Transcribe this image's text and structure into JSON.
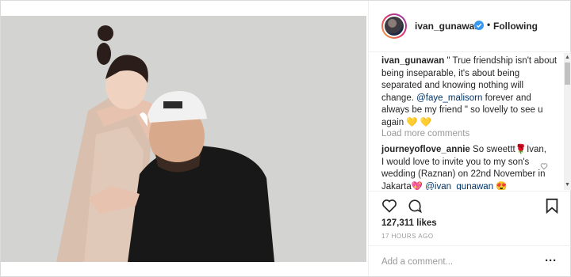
{
  "header": {
    "username": "ivan_gunawan",
    "separator": "•",
    "follow_state": "Following"
  },
  "caption": {
    "username": "ivan_gunawan",
    "text_before_mention": " \" True friendship isn't about being inseparable, it's about being separated and knowing nothing will change. ",
    "mention": "@faye_malisorn",
    "text_after_mention": " forever and always be my friend \" so lovelly to see u again ",
    "emoji": "💛 💛"
  },
  "comments": {
    "load_more": "Load more comments",
    "items": [
      {
        "username": "journeyoflove_annie",
        "text_before": " So sweettt",
        "emoji_1": "🌹",
        "text_middle": "Ivan, I would love to invite you to my son's wedding (Raznan) on 22nd November in Jakarta",
        "emoji_2": "💖",
        "mention": "@ivan_gunawan",
        "emoji_3": "😍"
      }
    ]
  },
  "likes": "127,311 likes",
  "timestamp": "17 HOURS AGO",
  "add_comment": {
    "placeholder": "Add a comment..."
  },
  "more_options": "···",
  "colors": {
    "verified": "#3897f0",
    "mention": "#003569",
    "muted": "#999999"
  },
  "icons": [
    "verified-badge-icon",
    "like-heart-icon",
    "comment-bubble-icon",
    "bookmark-icon",
    "comment-like-heart-icon",
    "more-options-icon"
  ]
}
